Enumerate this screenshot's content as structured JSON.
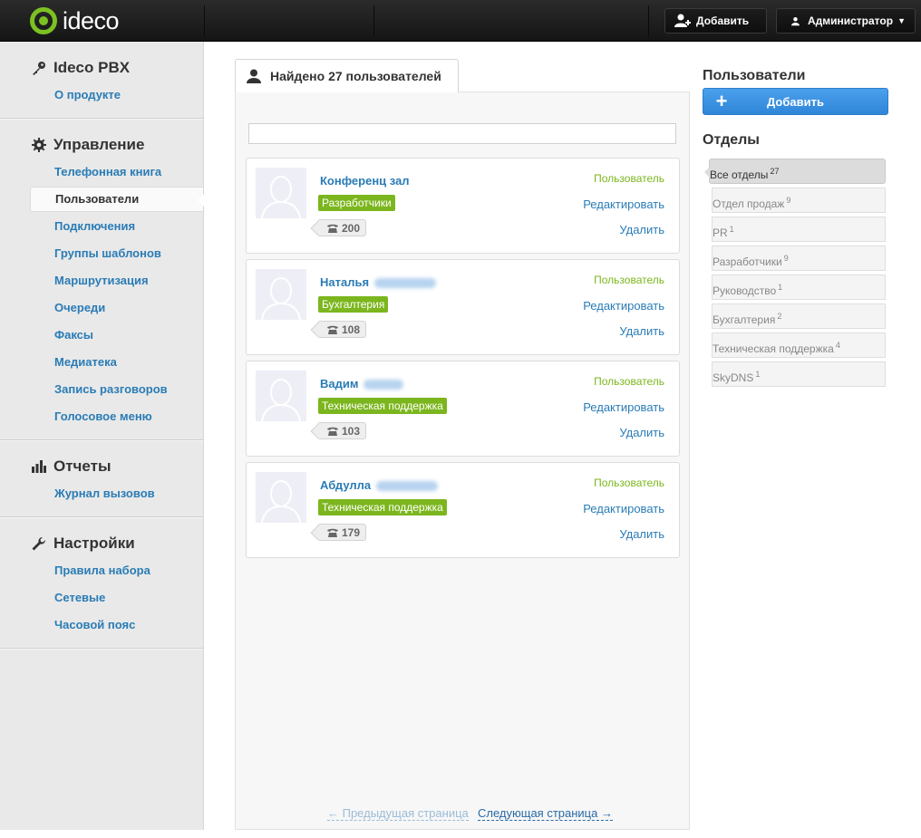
{
  "topbar": {
    "logo_text": "ideco",
    "add_label": "Добавить",
    "admin_label": "Администратор"
  },
  "sidebar": {
    "sections": [
      {
        "title": "Ideco PBX",
        "icon": "key-icon",
        "items": [
          {
            "label": "О продукте"
          }
        ]
      },
      {
        "title": "Управление",
        "icon": "gear-icon",
        "items": [
          {
            "label": "Телефонная книга"
          },
          {
            "label": "Пользователи",
            "active": true
          },
          {
            "label": "Подключения"
          },
          {
            "label": "Группы шаблонов"
          },
          {
            "label": "Маршрутизация"
          },
          {
            "label": "Очереди"
          },
          {
            "label": "Факсы"
          },
          {
            "label": "Медиатека"
          },
          {
            "label": "Запись разговоров"
          },
          {
            "label": "Голосовое меню"
          }
        ]
      },
      {
        "title": "Отчеты",
        "icon": "bar-chart-icon",
        "items": [
          {
            "label": "Журнал вызовов"
          }
        ]
      },
      {
        "title": "Настройки",
        "icon": "wrench-icon",
        "items": [
          {
            "label": "Правила набора"
          },
          {
            "label": "Сетевые"
          },
          {
            "label": "Часовой пояс"
          }
        ]
      }
    ]
  },
  "main": {
    "tab_title": "Найдено 27 пользователей",
    "search_value": "",
    "users": [
      {
        "first_name": "Конференц зал",
        "surname_blurred": false,
        "department": "Разработчики",
        "extension": "200",
        "role": "Пользователь",
        "edit_label": "Редактировать",
        "delete_label": "Удалить"
      },
      {
        "first_name": "Наталья",
        "surname_blurred": true,
        "department": "Бухгалтерия",
        "extension": "108",
        "role": "Пользователь",
        "edit_label": "Редактировать",
        "delete_label": "Удалить"
      },
      {
        "first_name": "Вадим",
        "surname_blurred": true,
        "department": "Техническая поддержка",
        "extension": "103",
        "role": "Пользователь",
        "edit_label": "Редактировать",
        "delete_label": "Удалить"
      },
      {
        "first_name": "Абдулла",
        "surname_blurred": true,
        "department": "Техническая поддержка",
        "extension": "179",
        "role": "Пользователь",
        "edit_label": "Редактировать",
        "delete_label": "Удалить"
      }
    ],
    "prev_page": "← Предыдущая страница",
    "next_page": "Следующая страница →"
  },
  "right": {
    "users_title": "Пользователи",
    "add_button": "Добавить",
    "departments_title": "Отделы",
    "departments": [
      {
        "name": "Все отделы",
        "count": "27",
        "active": true
      },
      {
        "name": "Отдел продаж",
        "count": "9"
      },
      {
        "name": "PR",
        "count": "1"
      },
      {
        "name": "Разработчики",
        "count": "9"
      },
      {
        "name": "Руководство",
        "count": "1"
      },
      {
        "name": "Бухгалтерия",
        "count": "2"
      },
      {
        "name": "Техническая поддержка",
        "count": "4"
      },
      {
        "name": "SkyDNS",
        "count": "1"
      }
    ]
  },
  "colors": {
    "accent_green": "#7cb61e",
    "link_blue": "#2a7cb6",
    "button_blue": "#3a93e2",
    "topbar_dark": "#1c1c1c"
  }
}
